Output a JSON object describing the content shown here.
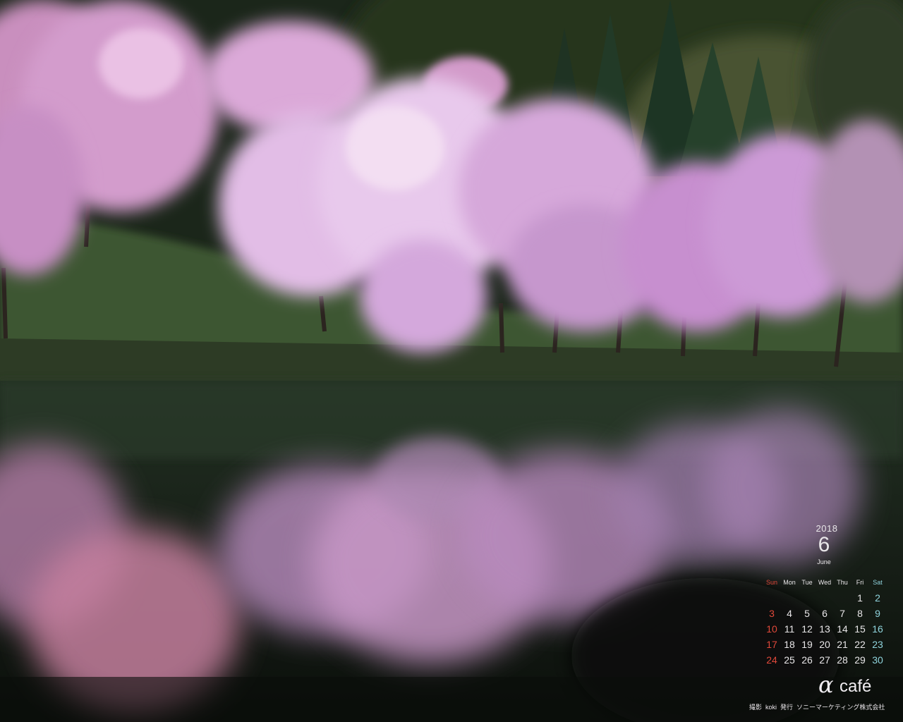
{
  "calendar": {
    "year": "2018",
    "month_number": "6",
    "month_name": "June",
    "weekdays": [
      "Sun",
      "Mon",
      "Tue",
      "Wed",
      "Thu",
      "Fri",
      "Sat"
    ],
    "weeks": [
      [
        "",
        "",
        "",
        "",
        "",
        "1",
        "2"
      ],
      [
        "3",
        "4",
        "5",
        "6",
        "7",
        "8",
        "9"
      ],
      [
        "10",
        "11",
        "12",
        "13",
        "14",
        "15",
        "16"
      ],
      [
        "17",
        "18",
        "19",
        "20",
        "21",
        "22",
        "23"
      ],
      [
        "24",
        "25",
        "26",
        "27",
        "28",
        "29",
        "30"
      ]
    ]
  },
  "brand": {
    "alpha": "α",
    "cafe": "café"
  },
  "credit": {
    "photo_label": "撮影",
    "photographer": "koki",
    "publisher_label": "発行",
    "publisher": "ソニーマーケティング株式会社"
  },
  "colors": {
    "sunday": "#e0483a",
    "saturday": "#8fd3dc",
    "text": "#e8e6e8",
    "blossom": "#d8a6dc",
    "forest": "#1d2a1c",
    "grass": "#3f5631",
    "water": "#0e140f"
  }
}
